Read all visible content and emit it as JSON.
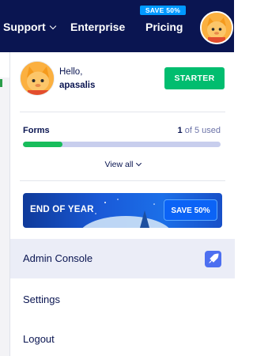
{
  "topnav": {
    "items": [
      {
        "label": "Support"
      },
      {
        "label": "Enterprise"
      },
      {
        "label": "Pricing"
      }
    ],
    "sale_badge": "SAVE 50%"
  },
  "user": {
    "greeting": "Hello,",
    "username": "apasalis",
    "plan_button": "STARTER"
  },
  "usage": {
    "label": "Forms",
    "used": "1",
    "of_text": " of 5 used",
    "fraction": 0.2,
    "view_all": "View all"
  },
  "promo": {
    "text": "END OF YEAR",
    "button": "SAVE 50%"
  },
  "menu": {
    "admin": "Admin Console",
    "settings": "Settings",
    "logout": "Logout"
  },
  "colors": {
    "nav_bg": "#0a1551",
    "accent_green": "#01bd6f",
    "progress_fill": "#18bd5b",
    "promo_button": "#0b63f6"
  },
  "icons": [
    "chevron-down-icon",
    "avatar",
    "rocket-icon"
  ]
}
